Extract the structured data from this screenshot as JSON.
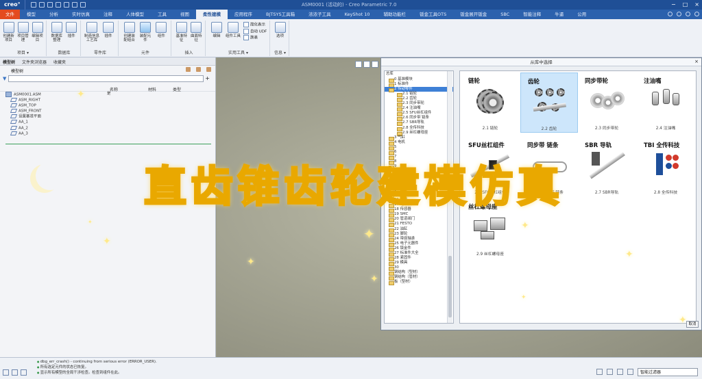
{
  "window": {
    "logo": "creo°",
    "title": "ASM0001 (活动的) - Creo Parametric 7.0",
    "controls": [
      "−",
      "□",
      "×"
    ]
  },
  "menubar": {
    "tabs": [
      "文件",
      "模型",
      "分析",
      "实时仿真",
      "注释",
      "人体模型",
      "工具",
      "视图",
      "柔性建模",
      "应用程序",
      "BJTSYS工具箱",
      "浓浓子工具",
      "KeyShot 10",
      "辅助功能栏",
      "钣金工具OTS",
      "钣金展开钣金",
      "SBC",
      "智能注释",
      "牛逼",
      "公用"
    ],
    "active_index": 8
  },
  "ribbon": {
    "groups": [
      {
        "label": "项目 ▾",
        "buttons": [
          "创建新项目",
          "项目管理",
          "编辑项目"
        ]
      },
      {
        "label": "数据库",
        "buttons": [
          "数据库整理",
          "插件"
        ]
      },
      {
        "label": "零件库",
        "buttons": [
          "制造信息工艺库",
          "插件"
        ]
      },
      {
        "label": "元件",
        "buttons": [
          "创建装配组合",
          "装配元件",
          "组件"
        ]
      },
      {
        "label": "插入",
        "buttons": [
          "基准特征",
          "曲面特征"
        ]
      },
      {
        "label": "实用工具 ▾",
        "buttons": [
          "编辑",
          "组件工具"
        ],
        "small": [
          "简化表示",
          "自动 UDF",
          "族表"
        ]
      },
      {
        "label": "信息 ▾",
        "buttons": [
          "选项"
        ]
      }
    ]
  },
  "left_panel": {
    "nav_tabs": [
      "模型树",
      "文件夹浏览器",
      "收藏夹"
    ],
    "tree_header": "模型树",
    "filter_placeholder": "",
    "columns": {
      "name": "名称",
      "material": "材料",
      "type": "类型"
    },
    "root_extra": "是",
    "tree": [
      "ASM0001.ASM",
      "ASM_RIGHT",
      "ASM_TOP",
      "ASM_FRONT",
      "设置基准平面",
      "AA_1",
      "AA_2",
      "AA_3"
    ]
  },
  "dialog": {
    "title": "从库中选择",
    "close": "×",
    "tree_caption": "总库",
    "tree_nodes": [
      {
        "label": "0 基准模块",
        "sub": false
      },
      {
        "label": "1 标准件",
        "sub": false
      },
      {
        "label": "2 传动零件",
        "sub": false,
        "selected": true
      },
      {
        "label": "2.1 链轮",
        "sub": true
      },
      {
        "label": "2.2 齿轮",
        "sub": true
      },
      {
        "label": "2.3 同步带轮",
        "sub": true
      },
      {
        "label": "2.4 注油嘴",
        "sub": true
      },
      {
        "label": "2.5 SFU丝杠组件",
        "sub": true
      },
      {
        "label": "2.6 同步带 链条",
        "sub": true
      },
      {
        "label": "2.7 SBR导轨",
        "sub": true
      },
      {
        "label": "2.8 全传科技",
        "sub": true
      },
      {
        "label": "2.9 丝杠螺母座",
        "sub": true
      },
      {
        "label": "3 气缸",
        "sub": false
      },
      {
        "label": "4 电机",
        "sub": false
      },
      {
        "label": "5 ",
        "sub": false
      },
      {
        "label": "6 ",
        "sub": false
      },
      {
        "label": "7 ",
        "sub": false
      },
      {
        "label": "8 ",
        "sub": false
      },
      {
        "label": "9 ",
        "sub": false
      },
      {
        "label": "10 ",
        "sub": false
      },
      {
        "label": "11 ",
        "sub": false
      },
      {
        "label": "12 ",
        "sub": false
      },
      {
        "label": "13 阀门",
        "sub": false
      },
      {
        "label": "14 型材",
        "sub": false
      },
      {
        "label": "15 直线模组",
        "sub": false
      },
      {
        "label": "16 吸盘",
        "sub": false
      },
      {
        "label": "17 电磁铁",
        "sub": false
      },
      {
        "label": "18 传感器",
        "sub": false
      },
      {
        "label": "19 SMC",
        "sub": false
      },
      {
        "label": "20 管道阀门",
        "sub": false
      },
      {
        "label": "21 FESTO",
        "sub": false
      },
      {
        "label": "22 油缸",
        "sub": false
      },
      {
        "label": "23 脚轮",
        "sub": false
      },
      {
        "label": "24 带座轴承",
        "sub": false
      },
      {
        "label": "25 电子元器件",
        "sub": false
      },
      {
        "label": "26 钣金件",
        "sub": false
      },
      {
        "label": "27 标准件大全",
        "sub": false
      },
      {
        "label": "28 紧固件",
        "sub": false
      },
      {
        "label": "29 模具",
        "sub": false
      },
      {
        "label": "30 ",
        "sub": false
      },
      {
        "label": "钢结构（型材）",
        "sub": false
      },
      {
        "label": "钢结构（管材）",
        "sub": false
      },
      {
        "label": "板（型材）",
        "sub": false
      }
    ],
    "cards": [
      {
        "title": "链轮",
        "caption": "2.1 链轮",
        "kind": "sprocket"
      },
      {
        "title": "齿轮",
        "caption": "2.2 齿轮",
        "kind": "gears",
        "selected": true
      },
      {
        "title": "同步带轮",
        "caption": "2.3 同步带轮",
        "kind": "pulley"
      },
      {
        "title": "注油嘴",
        "caption": "2.4 注油嘴",
        "kind": "nipple"
      },
      {
        "title": "SFU丝杠组件",
        "caption": "2.5 SFU丝杠组件",
        "kind": "screw"
      },
      {
        "title": "同步带 链条",
        "caption": "2.6 同步带 链条",
        "kind": "belt"
      },
      {
        "title": "SBR 导轨",
        "caption": "2.7 SBR导轨",
        "kind": "rail"
      },
      {
        "title": "TBI 全传科技",
        "caption": "2.8 全传科技",
        "kind": "logo"
      },
      {
        "title": "丝杠螺母座",
        "caption": "2.9 丝杠螺母座",
        "kind": "nut"
      }
    ],
    "cancel_label": "取消"
  },
  "overlay_title": "直齿锥齿轮建模仿真",
  "status": {
    "messages": [
      "dbg_err_crash() - continuing from serious error (ERROR_USER).",
      "所有选定元件的状态已恢复。",
      "显示所有模型的全局干涉检查。检查到组件在此。"
    ],
    "selection_filter": "智能过滤器"
  },
  "colors": {
    "menubar": "#2b61ad",
    "titlebar": "#1f4f96",
    "file_tab": "#e44b1f",
    "selection": "#3e80d6",
    "title_glow": "#e9a800"
  }
}
